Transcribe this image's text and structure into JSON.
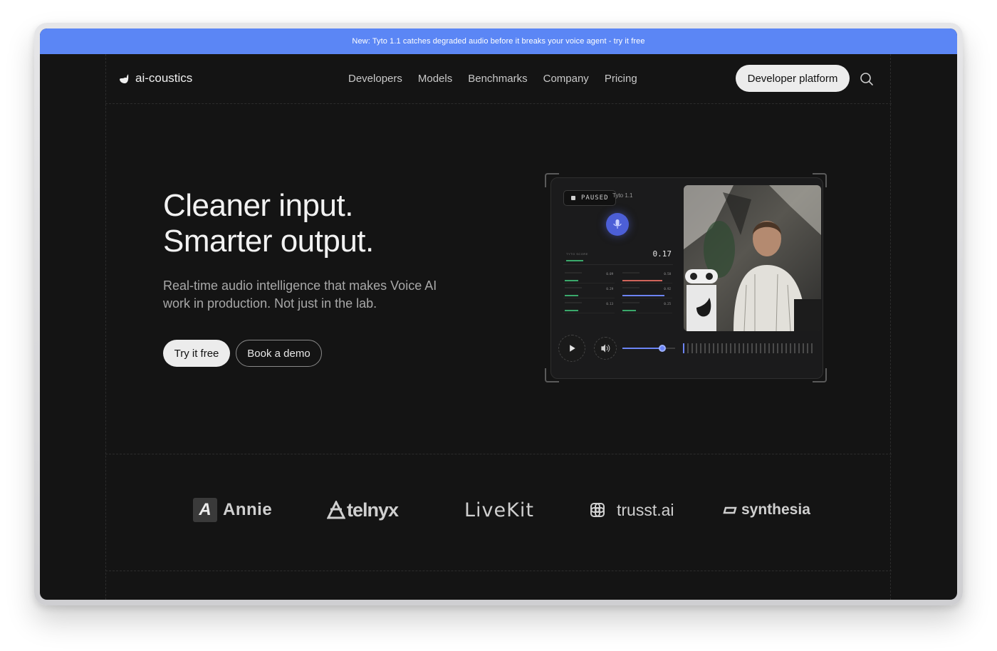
{
  "banner": {
    "text": "New: Tyto 1.1 catches degraded audio before it breaks your voice agent - try it free"
  },
  "nav": {
    "logo_text": "ai-coustics",
    "links": [
      "Developers",
      "Models",
      "Benchmarks",
      "Company",
      "Pricing"
    ],
    "cta": "Developer platform",
    "search_icon": "search-icon"
  },
  "hero": {
    "title_line1": "Cleaner input.",
    "title_line2": "Smarter output.",
    "subtitle": "Real-time audio intelligence that makes Voice AI work in production. Not just in the lab.",
    "primary_button": "Try it free",
    "secondary_button": "Book a demo"
  },
  "demo": {
    "status": "PAUSED",
    "model": "Tyto 1.1",
    "score_label": "TYTO SCORE",
    "score_value": "0.17",
    "metrics": [
      {
        "value": "0.09",
        "color": "#3aa86b",
        "level": 0.3
      },
      {
        "value": "0.58",
        "color": "#d0645a",
        "level": 0.9
      },
      {
        "value": "0.29",
        "color": "#3aa86b",
        "level": 0.3
      },
      {
        "value": "0.92",
        "color": "#6c84f5",
        "level": 0.95
      },
      {
        "value": "0.13",
        "color": "#3aa86b",
        "level": 0.3
      },
      {
        "value": "0.25",
        "color": "#3aa86b",
        "level": 0.3
      }
    ],
    "volume_level": 0.75,
    "icons": {
      "mic": "microphone-icon",
      "play": "play-icon",
      "volume": "speaker-icon"
    }
  },
  "partners": [
    "Annie",
    "telnyx",
    "LiveKit",
    "trusst.ai",
    "synthesia"
  ],
  "colors": {
    "banner": "#5b86f5",
    "background": "#141414",
    "accent": "#6c84f5"
  }
}
